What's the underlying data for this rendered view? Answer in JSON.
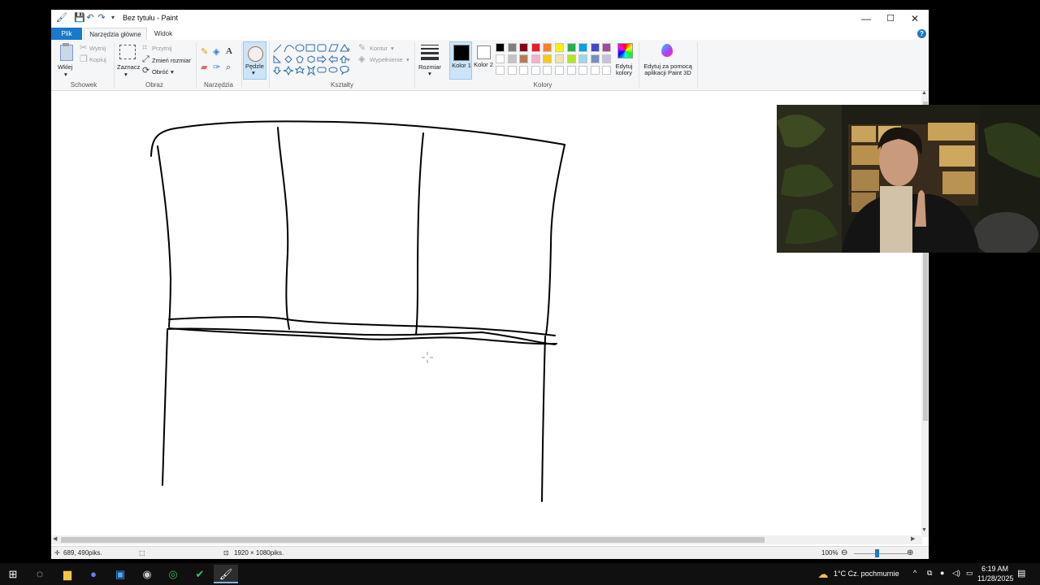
{
  "window": {
    "title": "Bez tytułu - Paint",
    "controls": {
      "minimize": "—",
      "maximize": "☐",
      "close": "✕"
    }
  },
  "tabs": {
    "file": "Plik",
    "home": "Narzędzia główne",
    "view": "Widok"
  },
  "ribbon": {
    "clipboard": {
      "paste": "Wklej",
      "cut": "Wytnij",
      "copy": "Kopiuj",
      "group": "Schowek"
    },
    "image": {
      "select": "Zaznacz",
      "crop": "Przytnij",
      "resize": "Zmień rozmiar",
      "rotate": "Obróć",
      "group": "Obraz"
    },
    "tools": {
      "group": "Narzędzia"
    },
    "brushes": {
      "label": "Pędzle"
    },
    "shapes": {
      "outline": "Kontur",
      "fill": "Wypełnienie",
      "group": "Kształty"
    },
    "size": {
      "label": "Rozmiar"
    },
    "colors": {
      "color1": "Kolor 1",
      "color2": "Kolor 2",
      "edit": "Edytuj kolory",
      "group": "Kolory",
      "color1_value": "#000000",
      "color2_value": "#ffffff",
      "palette_row1": [
        "#000000",
        "#7f7f7f",
        "#880015",
        "#ed1c24",
        "#ff7f27",
        "#fff200",
        "#22b14c",
        "#00a2e8",
        "#3f48cc",
        "#a349a4"
      ],
      "palette_row2": [
        "#ffffff",
        "#c3c3c3",
        "#b97a57",
        "#ffaec9",
        "#ffc90e",
        "#efe4b0",
        "#b5e61d",
        "#99d9ea",
        "#7092be",
        "#c8bfe7"
      ]
    },
    "paint3d": {
      "label": "Edytuj za pomocą aplikacji Paint 3D"
    }
  },
  "status": {
    "cursor_pos": "689, 490piks.",
    "image_size": "1920 × 1080piks.",
    "zoom": "100%"
  },
  "taskbar": {
    "weather": "1°C  Cz. pochmurnie",
    "time": "6:19 AM",
    "date": "11/28/2025"
  }
}
